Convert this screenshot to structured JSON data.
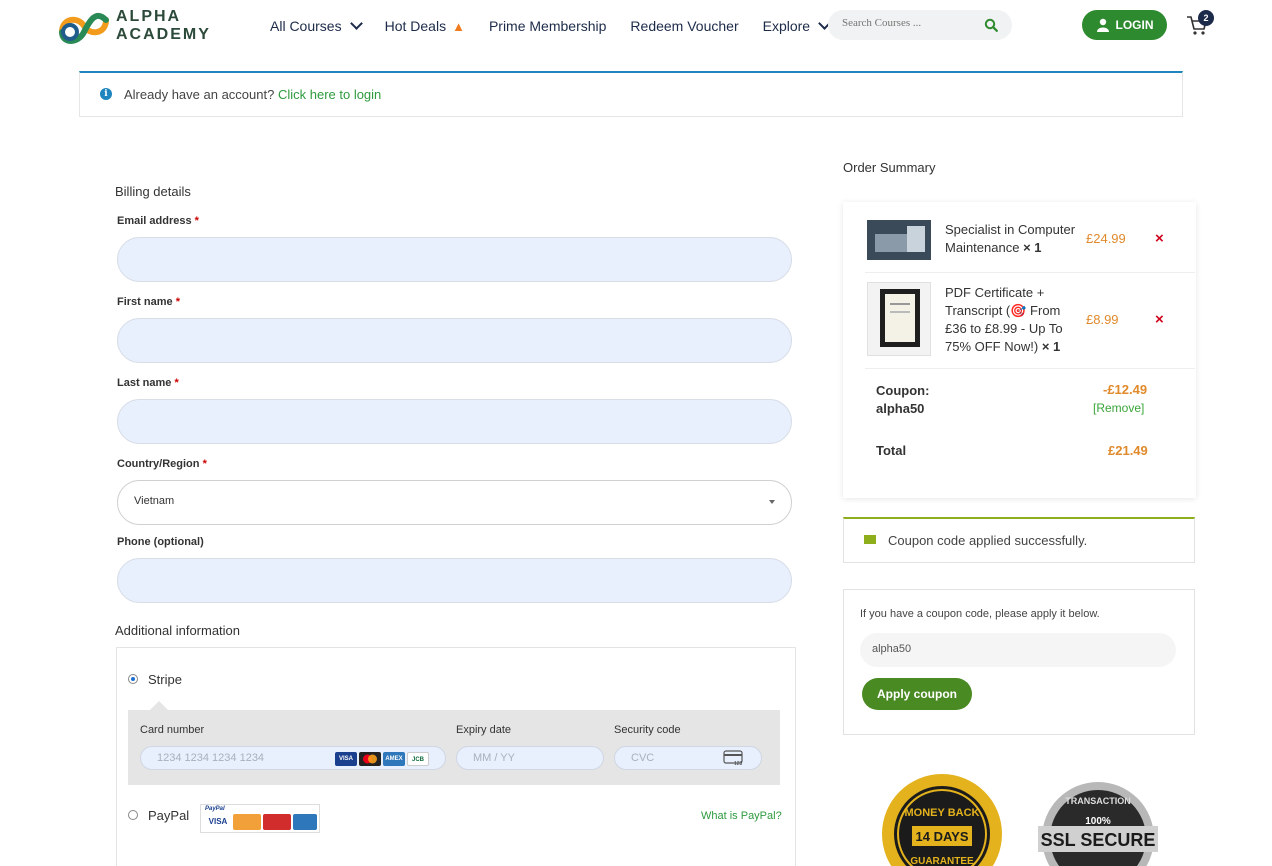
{
  "header": {
    "logo_line1": "ALPHA",
    "logo_line2": "ACADEMY",
    "nav": [
      "All Courses",
      "Hot Deals",
      "Prime Membership",
      "Redeem Voucher",
      "Explore"
    ],
    "search_placeholder": "Search Courses ...",
    "login_label": "LOGIN",
    "cart_count": "2"
  },
  "notice": {
    "text": "Already have an account?",
    "link": "Click here to login"
  },
  "billing": {
    "title": "Billing details",
    "email_label": "Email address",
    "first_name_label": "First name",
    "last_name_label": "Last name",
    "country_label": "Country/Region",
    "country_value": "Vietnam",
    "phone_label": "Phone (optional)",
    "required_mark": "*"
  },
  "additional": {
    "title": "Additional information"
  },
  "payment": {
    "stripe_label": "Stripe",
    "card_number_label": "Card number",
    "card_number_placeholder": "1234 1234 1234 1234",
    "expiry_label": "Expiry date",
    "expiry_placeholder": "MM / YY",
    "cvc_label": "Security code",
    "cvc_placeholder": "CVC",
    "paypal_label": "PayPal",
    "what_is_paypal": "What is PayPal?",
    "card_brands": [
      "VISA",
      "MC",
      "AMEX",
      "JCB"
    ],
    "paypal_brand": "PayPal",
    "cvc_icon_text": "123"
  },
  "order_summary": {
    "title": "Order Summary",
    "items": [
      {
        "name": "Specialist in Computer Maintenance",
        "qty": "× 1",
        "price": "£24.99"
      },
      {
        "name": "PDF Certificate + Transcript (🎯 From £36 to £8.99 - Up To 75% OFF Now!)",
        "qty": "× 1",
        "price": "£8.99"
      }
    ],
    "remove_symbol": "×",
    "coupon_label": "Coupon:",
    "coupon_code": "alpha50",
    "discount": "-£12.49",
    "remove_link": "[Remove]",
    "total_label": "Total",
    "total": "£21.49"
  },
  "coupon_message": "Coupon code applied successfully.",
  "coupon_form": {
    "hint": "If you have a coupon code, please apply it below.",
    "value": "alpha50",
    "button": "Apply coupon"
  },
  "badges": {
    "money_back_top": "MONEY BACK",
    "money_back_days": "14 DAYS",
    "money_back_bottom": "GUARANTEE",
    "ssl_top": "TRANSACTION",
    "ssl_pct": "100%",
    "ssl_main": "SSL SECURE"
  },
  "colors": {
    "brand_green": "#2e8a2e",
    "accent_orange": "#e08a2c",
    "info_blue": "#1e85be",
    "success_green": "#8fae1b"
  }
}
